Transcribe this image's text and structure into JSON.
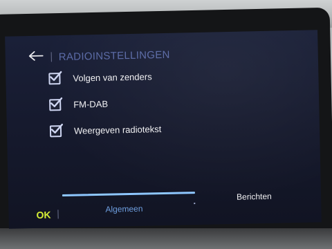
{
  "header": {
    "title": "RADIOINSTELLINGEN"
  },
  "settings": [
    {
      "label": "Volgen van zenders",
      "checked": true
    },
    {
      "label": "FM-DAB",
      "checked": true
    },
    {
      "label": "Weergeven radiotekst",
      "checked": true
    }
  ],
  "footer": {
    "ok_label": "OK",
    "tabs": [
      {
        "label": "Algemeen",
        "active": true
      },
      {
        "label": "Berichten",
        "active": false
      }
    ]
  },
  "colors": {
    "title": "#5a6aa6",
    "ok": "#d6ef36",
    "active_tab": "#6f9fe0",
    "indicator": "#8ec7ff",
    "check": "#cfd6f2",
    "text": "#f2f2f4"
  }
}
